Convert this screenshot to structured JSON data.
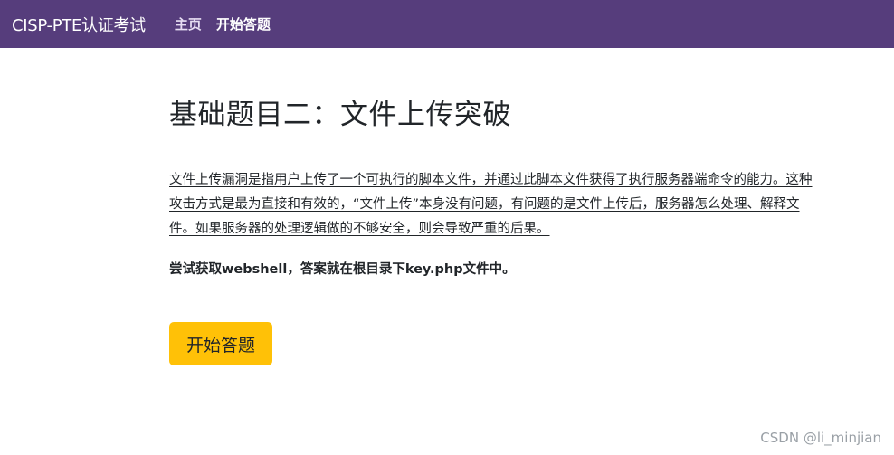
{
  "navbar": {
    "brand": "CISP-PTE认证考试",
    "items": [
      {
        "label": "主页"
      },
      {
        "label": "开始答题"
      }
    ]
  },
  "main": {
    "title": "基础题目二：文件上传突破",
    "description": "文件上传漏洞是指用户上传了一个可执行的脚本文件，并通过此脚本文件获得了执行服务器端命令的能力。这种攻击方式是最为直接和有效的，“文件上传”本身没有问题，有问题的是文件上传后，服务器怎么处理、解释文件。如果服务器的处理逻辑做的不够安全，则会导致严重的后果。",
    "hint": "尝试获取webshell，答案就在根目录下key.php文件中。",
    "start_button": "开始答题"
  },
  "watermark": "CSDN @li_minjian",
  "colors": {
    "navbar_bg": "#563d7c",
    "button_bg": "#ffc107"
  }
}
